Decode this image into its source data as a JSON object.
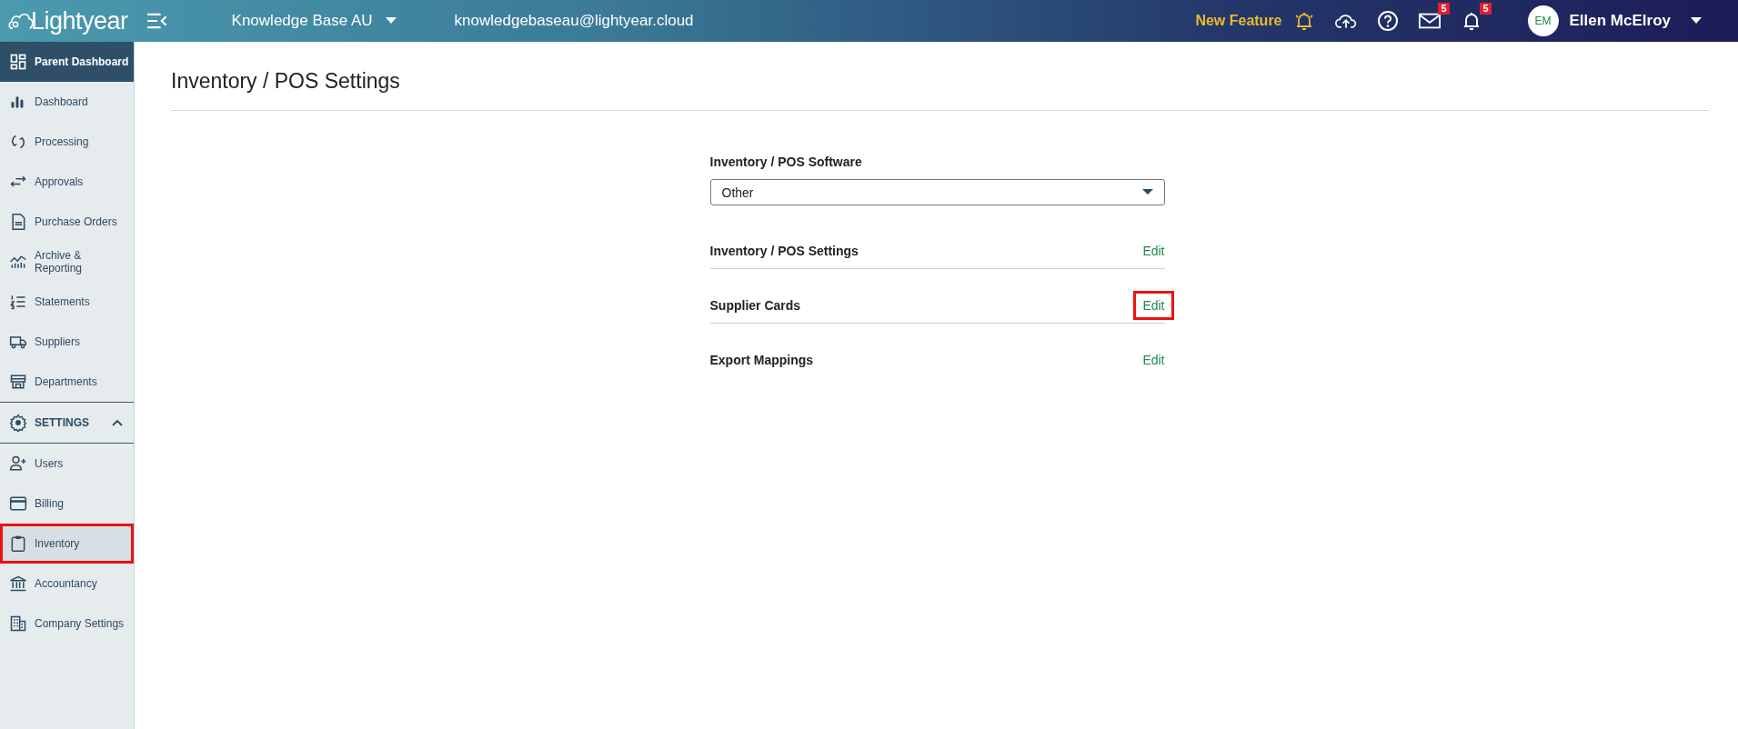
{
  "topbar": {
    "logo": "Lightyear",
    "company": "Knowledge Base AU",
    "email": "knowledgebaseau@lightyear.cloud",
    "new_feature": "New Feature",
    "mail_badge": "5",
    "alerts_badge": "5",
    "avatar": "EM",
    "user": "Ellen McElroy"
  },
  "sidebar": {
    "parent": {
      "label": "Parent Dashboard"
    },
    "items": [
      {
        "label": "Dashboard",
        "selected": false
      },
      {
        "label": "Processing",
        "selected": false
      },
      {
        "label": "Approvals",
        "selected": false
      },
      {
        "label": "Purchase Orders",
        "selected": false
      },
      {
        "label": "Archive & Reporting",
        "selected": false
      },
      {
        "label": "Statements",
        "selected": false
      },
      {
        "label": "Suppliers",
        "selected": false
      },
      {
        "label": "Departments",
        "selected": false
      }
    ],
    "settings": {
      "label": "SETTINGS",
      "expanded": true,
      "items": [
        {
          "label": "Users",
          "selected": false,
          "highlighted": false
        },
        {
          "label": "Billing",
          "selected": false,
          "highlighted": false
        },
        {
          "label": "Inventory",
          "selected": true,
          "highlighted": true
        },
        {
          "label": "Accountancy",
          "selected": false,
          "highlighted": false
        },
        {
          "label": "Company Settings",
          "selected": false,
          "highlighted": false
        }
      ]
    }
  },
  "page": {
    "title": "Inventory / POS Settings",
    "software": {
      "label": "Inventory / POS Software",
      "value": "Other"
    },
    "rows": [
      {
        "label": "Inventory / POS Settings",
        "action": "Edit",
        "highlighted": false
      },
      {
        "label": "Supplier Cards",
        "action": "Edit",
        "highlighted": true
      },
      {
        "label": "Export Mappings",
        "action": "Edit",
        "highlighted": false
      }
    ]
  }
}
